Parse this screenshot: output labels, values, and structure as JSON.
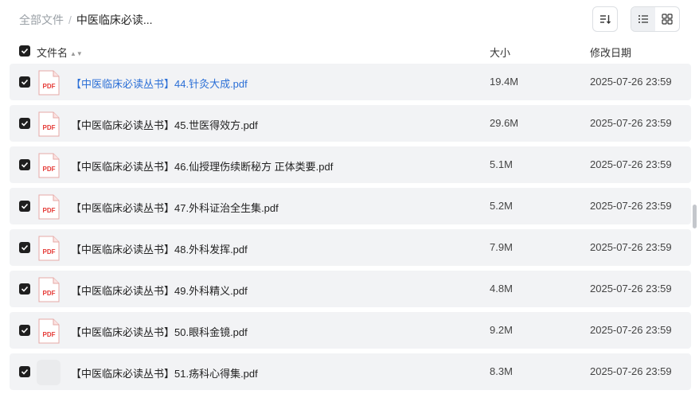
{
  "breadcrumb": {
    "root": "全部文件",
    "separator": "/",
    "current": "中医临床必读..."
  },
  "toolbar": {
    "sort_icon": "sort-icon",
    "list_view_icon": "list-view-icon",
    "grid_view_icon": "grid-view-icon",
    "active_view": "list"
  },
  "columns": {
    "name": "文件名",
    "size": "大小",
    "modified": "修改日期"
  },
  "colors": {
    "accent_link": "#2b6fd6",
    "row_bg": "#f2f3f5",
    "checkbox": "#1f1f1f",
    "pdf_red": "#e53935"
  },
  "files": [
    {
      "name": "【中医临床必读丛书】44.针灸大成.pdf",
      "size": "19.4M",
      "modified": "2025-07-26 23:59",
      "icon": "pdf-icon",
      "checked": true,
      "hovered": true
    },
    {
      "name": "【中医临床必读丛书】45.世医得效方.pdf",
      "size": "29.6M",
      "modified": "2025-07-26 23:59",
      "icon": "pdf-icon",
      "checked": true
    },
    {
      "name": "【中医临床必读丛书】46.仙授理伤续断秘方 正体类要.pdf",
      "size": "5.1M",
      "modified": "2025-07-26 23:59",
      "icon": "pdf-icon",
      "checked": true
    },
    {
      "name": "【中医临床必读丛书】47.外科证治全生集.pdf",
      "size": "5.2M",
      "modified": "2025-07-26 23:59",
      "icon": "pdf-icon",
      "checked": true
    },
    {
      "name": "【中医临床必读丛书】48.外科发挥.pdf",
      "size": "7.9M",
      "modified": "2025-07-26 23:59",
      "icon": "pdf-icon",
      "checked": true
    },
    {
      "name": "【中医临床必读丛书】49.外科精义.pdf",
      "size": "4.8M",
      "modified": "2025-07-26 23:59",
      "icon": "pdf-icon",
      "checked": true
    },
    {
      "name": "【中医临床必读丛书】50.眼科金镜.pdf",
      "size": "9.2M",
      "modified": "2025-07-26 23:59",
      "icon": "pdf-icon",
      "checked": true
    },
    {
      "name": "【中医临床必读丛书】51.疡科心得集.pdf",
      "size": "8.3M",
      "modified": "2025-07-26 23:59",
      "icon": "file-placeholder-icon",
      "checked": true
    }
  ]
}
